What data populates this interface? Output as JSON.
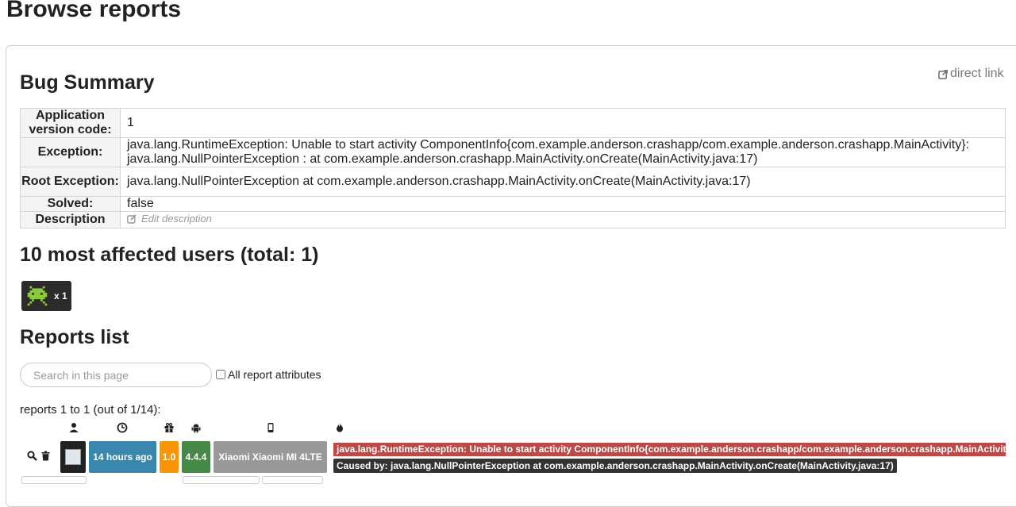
{
  "page": {
    "title": "Browse reports"
  },
  "bug_summary": {
    "title": "Bug Summary",
    "direct_link": "direct link",
    "rows": {
      "app_version": {
        "label": "Application version code:",
        "value": "1"
      },
      "exception": {
        "label": "Exception:",
        "value": "java.lang.RuntimeException: Unable to start activity ComponentInfo{com.example.anderson.crashapp/com.example.anderson.crashapp.MainActivity}: java.lang.NullPointerException : at com.example.anderson.crashapp.MainActivity.onCreate(MainActivity.java:17)"
      },
      "root_exception": {
        "label": "Root Exception:",
        "value": "java.lang.NullPointerException at com.example.anderson.crashapp.MainActivity.onCreate(MainActivity.java:17)"
      },
      "solved": {
        "label": "Solved:",
        "value": "false"
      },
      "description": {
        "label": "Description",
        "edit_label": "Edit description"
      }
    }
  },
  "affected_users": {
    "title": "10 most affected users (total: 1)",
    "users": [
      {
        "count_label": "x 1",
        "icon": "space-invader-avatar"
      }
    ]
  },
  "reports_list": {
    "title": "Reports list",
    "search_placeholder": "Search in this page",
    "all_attributes_label": "All report attributes",
    "range_text": "reports 1 to 1 (out of 1/14):",
    "column_icons": [
      "user-icon",
      "clock-icon",
      "gift-icon",
      "android-icon",
      "mobile-icon",
      "fire-icon"
    ],
    "rows": [
      {
        "time": "14 hours ago",
        "app_version": "1.0",
        "android_version": "4.4.4",
        "device": "Xiaomi Xiaomi MI 4LTE",
        "exception": "java.lang.RuntimeException: Unable to start activity ComponentInfo{com.example.anderson.crashapp/com.example.anderson.crashapp.MainActivity}: java.lang.NullPointerException",
        "cause": "Caused by: java.lang.NullPointerException at com.example.anderson.crashapp.MainActivity.onCreate(MainActivity.java:17)"
      }
    ]
  },
  "colors": {
    "time_tag": "#3a87ad",
    "version_tag": "#f89406",
    "os_tag": "#468847",
    "device_tag": "#999999",
    "exception_tag": "#b94a48",
    "cause_tag": "#333333"
  }
}
